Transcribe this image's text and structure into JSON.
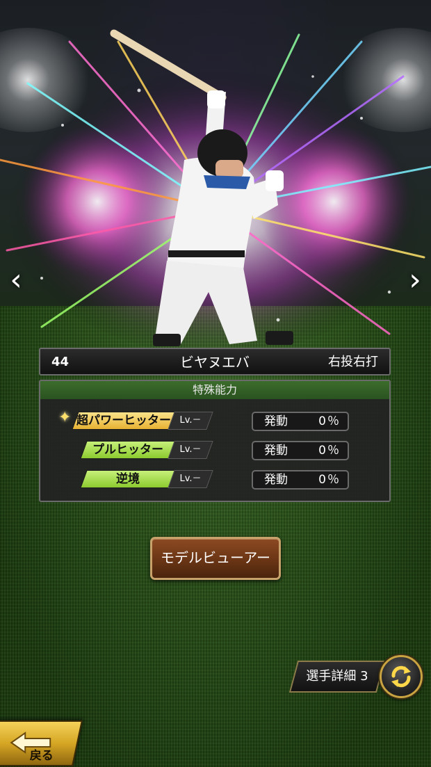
{
  "nav": {
    "prev_arrow": "‹",
    "next_arrow": "›"
  },
  "player": {
    "number": "44",
    "name": "ビヤヌエバ",
    "handedness": "右投右打"
  },
  "abilities": {
    "header": "特殊能力",
    "items": [
      {
        "name": "超パワーヒッター",
        "badge": "超",
        "level": "Lv.－",
        "activation_label": "発動",
        "activation_value": "0％",
        "color": "#f0c24a"
      },
      {
        "name": "プルヒッター",
        "level": "Lv.－",
        "activation_label": "発動",
        "activation_value": "0％",
        "color": "#a7dd4a"
      },
      {
        "name": "逆境",
        "level": "Lv.－",
        "activation_label": "発動",
        "activation_value": "0％",
        "color": "#a7dd4a"
      }
    ]
  },
  "buttons": {
    "model_viewer": "モデルビューアー",
    "player_detail": "選手詳細 3",
    "back": "戻る"
  },
  "icons": {
    "prev": "chevron-left-icon",
    "next": "chevron-right-icon",
    "refresh": "refresh-icon",
    "back": "back-arrow-icon",
    "sparkle": "sparkle-icon"
  }
}
